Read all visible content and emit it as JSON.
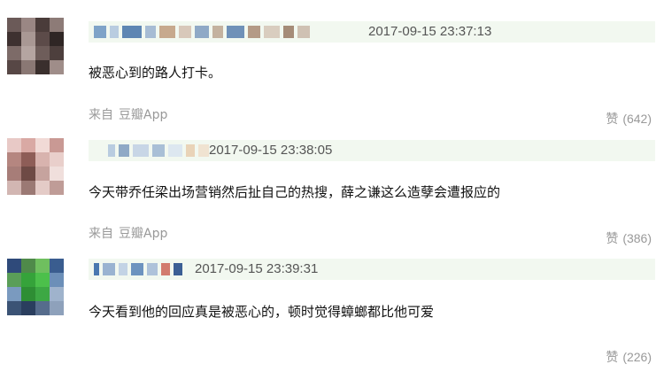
{
  "comments": [
    {
      "timestamp": "2017-09-15 23:37:13",
      "text": "被恶心到的路人打卡。",
      "source_prefix": "来自",
      "source_app": "豆瓣App",
      "like_label": "赞",
      "like_count": "(642)"
    },
    {
      "timestamp": "2017-09-15 23:38:05",
      "text": "今天带乔任梁出场营销然后扯自己的热搜，薛之谦这么造孽会遭报应的",
      "source_prefix": "来自",
      "source_app": "豆瓣App",
      "like_label": "赞",
      "like_count": "(386)"
    },
    {
      "timestamp": "2017-09-15 23:39:31",
      "text": "今天看到他的回应真是被恶心的，顿时觉得蟑螂都比他可爱",
      "source_prefix": "",
      "source_app": "",
      "like_label": "赞",
      "like_count": "(226)"
    }
  ],
  "colors": {
    "header_bg": "#f2f8f0",
    "meta_text": "#999999",
    "body_text": "#111111",
    "timestamp_text": "#555555"
  }
}
